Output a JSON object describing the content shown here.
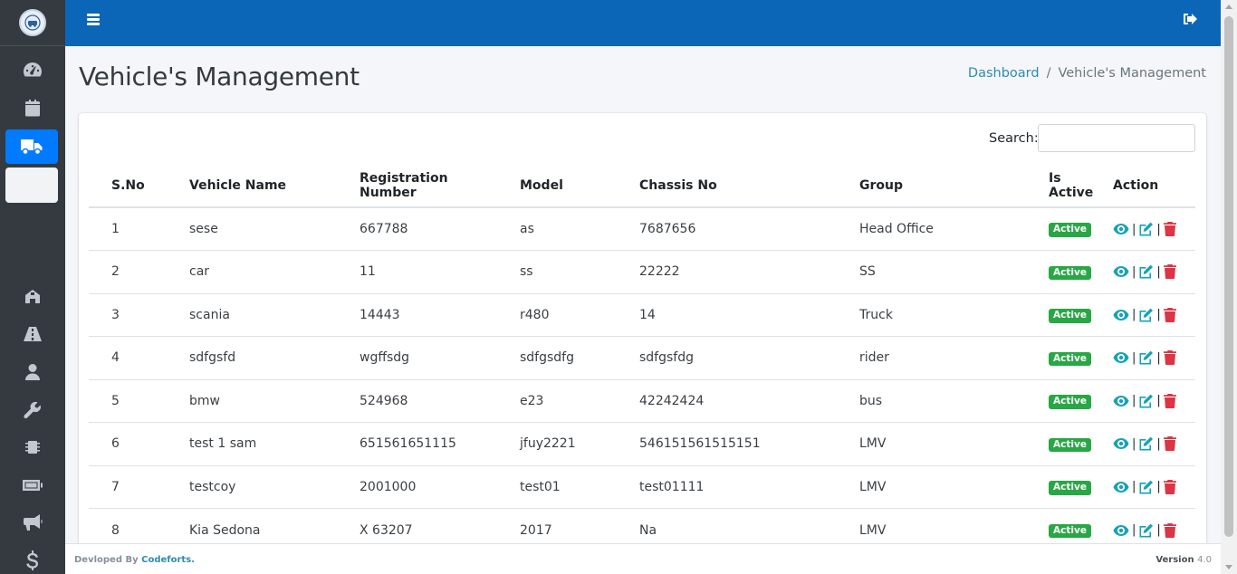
{
  "page": {
    "title": "Vehicle's Management"
  },
  "breadcrumb": {
    "home": "Dashboard",
    "separator": "/",
    "current": "Vehicle's Management"
  },
  "sidebar": {
    "icons": [
      "tachometer-icon",
      "calendar-icon",
      "truck-icon",
      "building-icon",
      "road-icon",
      "user-icon",
      "wrench-icon",
      "chip-icon",
      "battery-icon",
      "bullhorn-icon",
      "dollar-icon"
    ],
    "active": "truck-icon"
  },
  "search": {
    "label": "Search:",
    "placeholder": ""
  },
  "table": {
    "headers": [
      "S.No",
      "Vehicle Name",
      "Registration Number",
      "Model",
      "Chassis No",
      "Group",
      "Is Active",
      "Action"
    ],
    "rows": [
      {
        "sno": "1",
        "name": "sese",
        "reg": "667788",
        "model": "as",
        "chassis": "7687656",
        "group": "Head Office",
        "status": "Active"
      },
      {
        "sno": "2",
        "name": "car",
        "reg": "11",
        "model": "ss",
        "chassis": "22222",
        "group": "SS",
        "status": "Active"
      },
      {
        "sno": "3",
        "name": "scania",
        "reg": "14443",
        "model": "r480",
        "chassis": "14",
        "group": "Truck",
        "status": "Active"
      },
      {
        "sno": "4",
        "name": "sdfgsfd",
        "reg": "wgffsdg",
        "model": "sdfgsdfg",
        "chassis": "sdfgsfdg",
        "group": "rider",
        "status": "Active"
      },
      {
        "sno": "5",
        "name": "bmw",
        "reg": "524968",
        "model": "e23",
        "chassis": "42242424",
        "group": "bus",
        "status": "Active"
      },
      {
        "sno": "6",
        "name": "test 1 sam",
        "reg": "651561651115",
        "model": "jfuy2221",
        "chassis": "546151561515151",
        "group": "LMV",
        "status": "Active"
      },
      {
        "sno": "7",
        "name": "testcoy",
        "reg": "2001000",
        "model": "test01",
        "chassis": "test01111",
        "group": "LMV",
        "status": "Active"
      },
      {
        "sno": "8",
        "name": "Kia Sedona",
        "reg": "X 63207",
        "model": "2017",
        "chassis": "Na",
        "group": "LMV",
        "status": "Active"
      }
    ]
  },
  "footer": {
    "prefix": "Devloped By",
    "brand": "Codeforts.",
    "version_label": "Version",
    "version": "4.0"
  },
  "colors": {
    "topbar": "#0b66b8",
    "sidebar": "#343a40",
    "active_badge": "#28a745",
    "view_icon": "#17a2b8",
    "delete_icon": "#dc3545"
  }
}
